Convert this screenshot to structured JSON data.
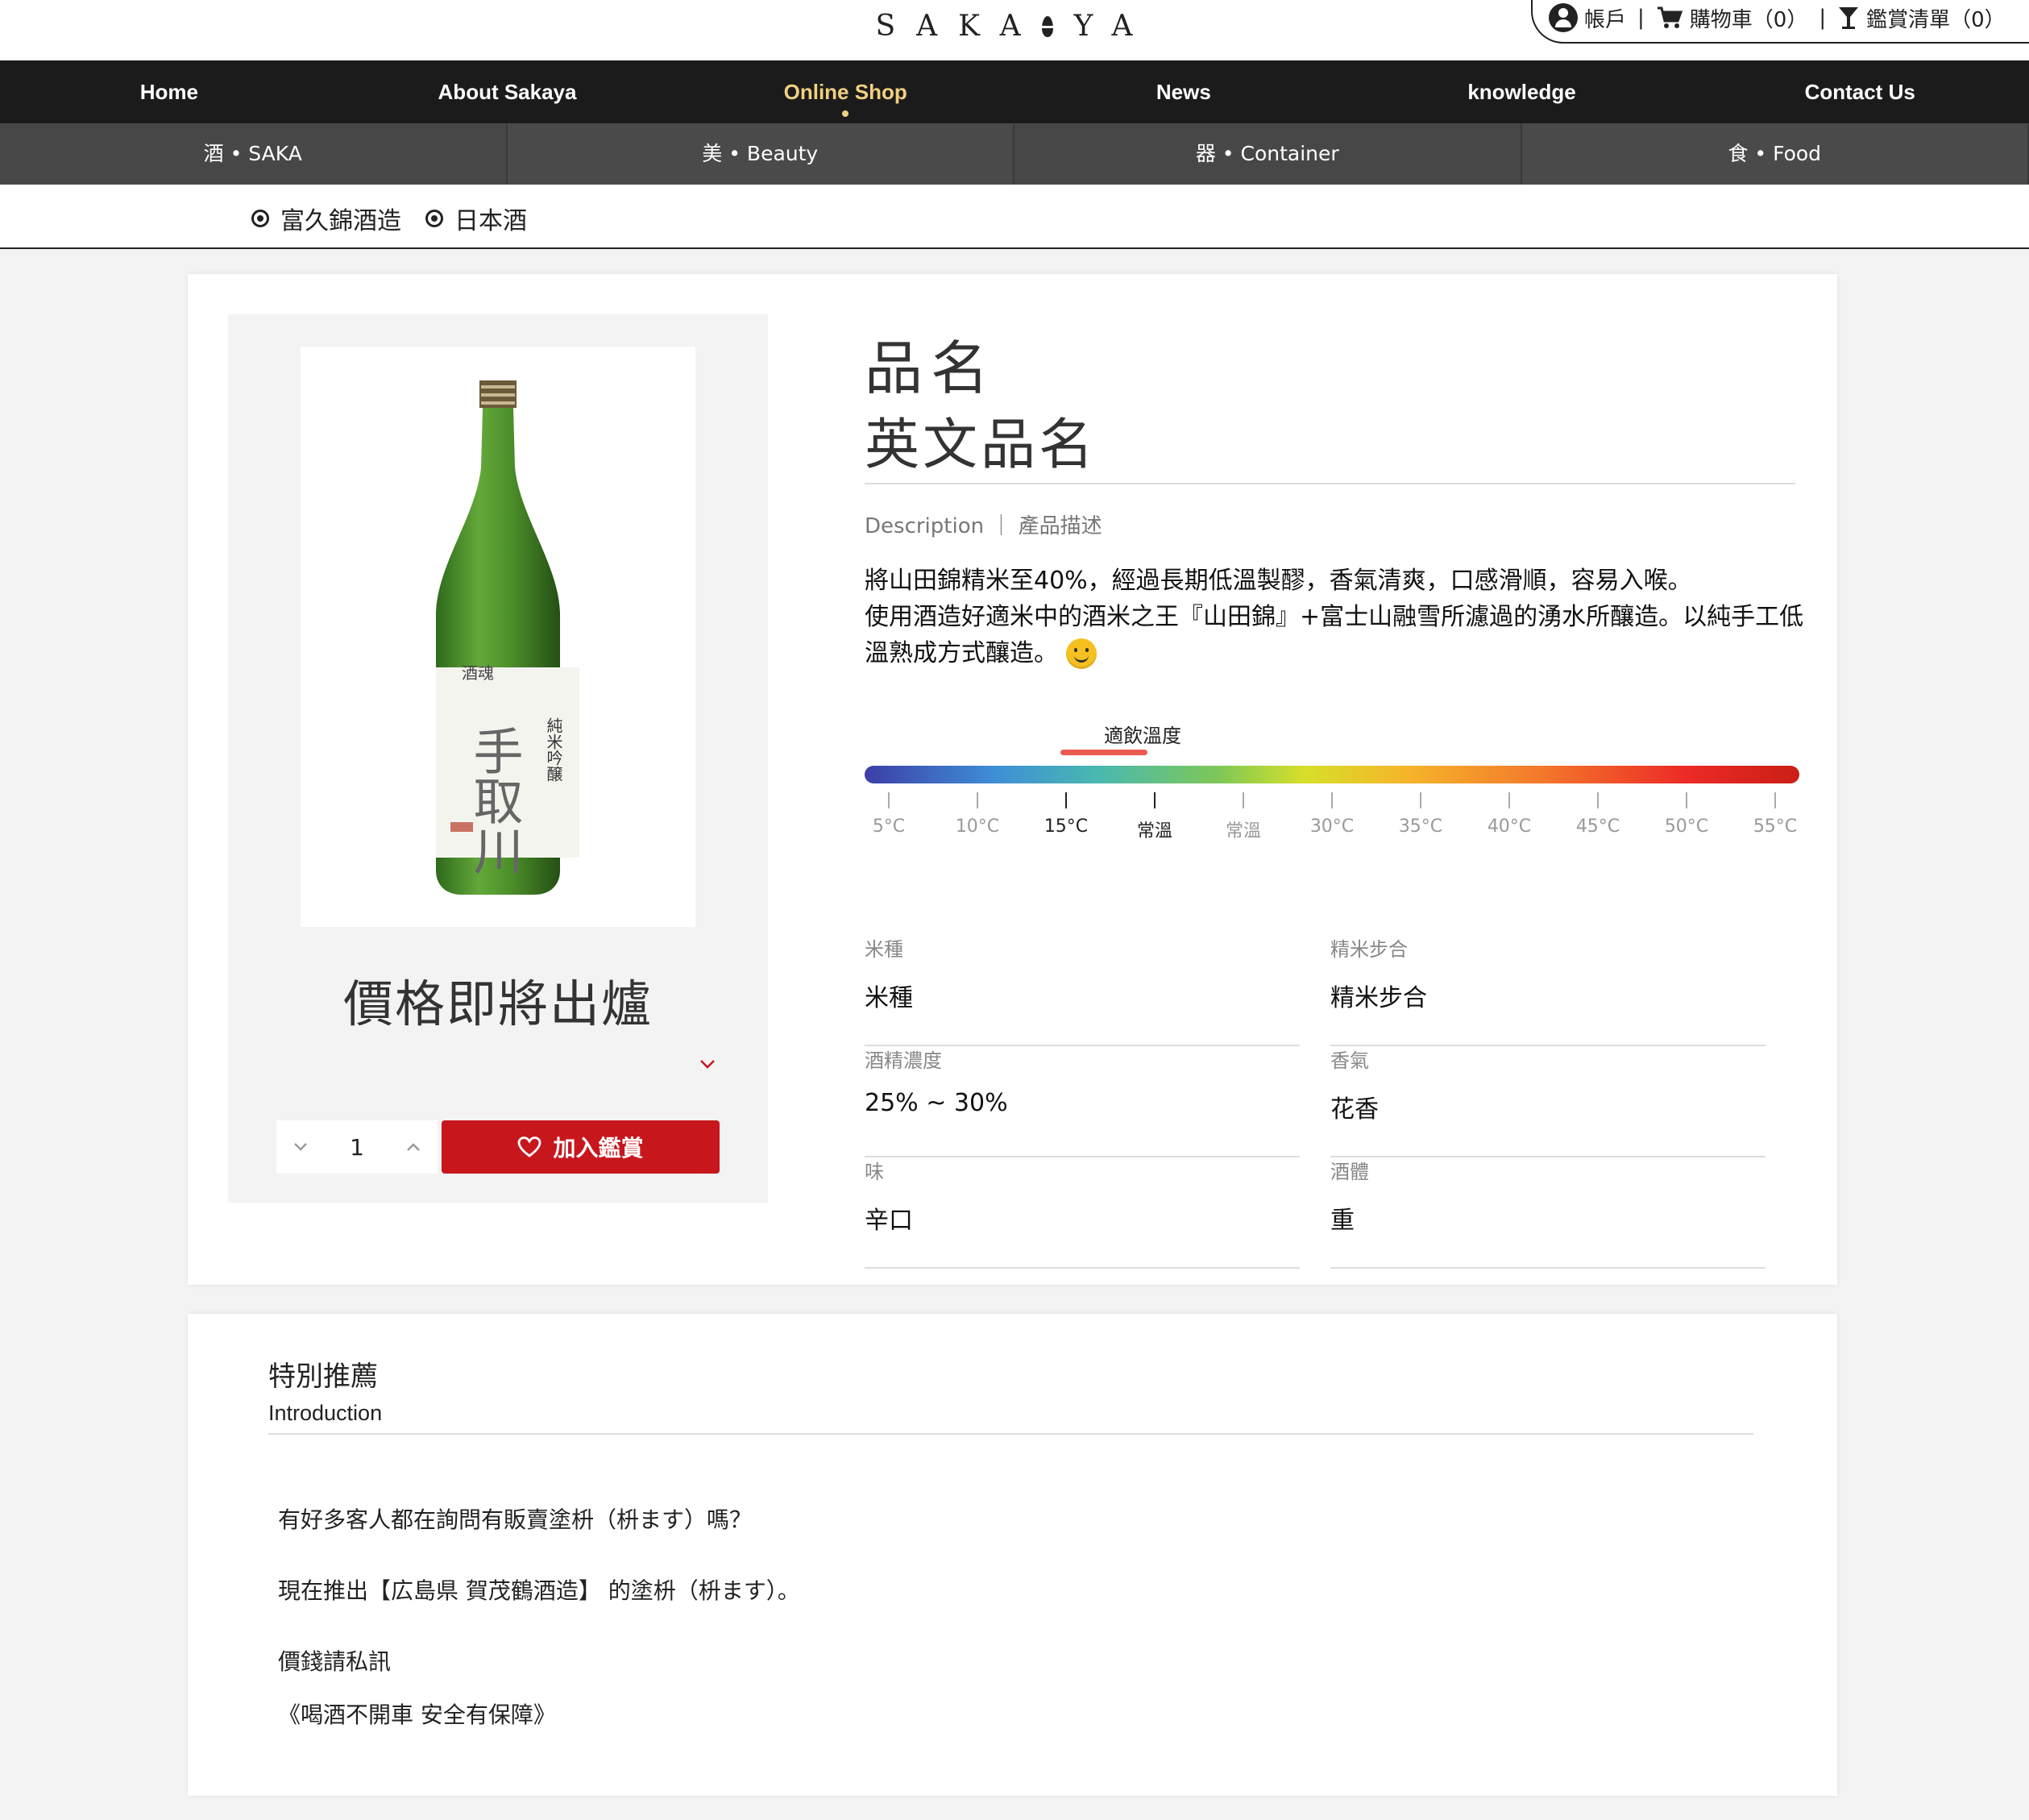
{
  "header": {
    "logo": "SAKA",
    "logo_end": "YA",
    "account_label": "帳戶",
    "cart_label": "購物車（0）",
    "wishlist_label": "鑑賞清單（0）"
  },
  "nav": {
    "items": [
      {
        "label": "Home"
      },
      {
        "label": "About Sakaya"
      },
      {
        "label": "Online Shop"
      },
      {
        "label": "News"
      },
      {
        "label": "knowledge"
      },
      {
        "label": "Contact Us"
      }
    ]
  },
  "subnav": {
    "items": [
      {
        "label": "酒 • SAKA"
      },
      {
        "label": "美 • Beauty"
      },
      {
        "label": "器 • Container"
      },
      {
        "label": "食 • Food"
      }
    ]
  },
  "breadcrumb": {
    "items": [
      {
        "label": "富久錦酒造"
      },
      {
        "label": "日本酒"
      }
    ]
  },
  "product": {
    "name": "品名",
    "english_name": "英文品名",
    "price_text": "價格即將出爐",
    "quantity": "1",
    "add_button": "加入鑑賞",
    "description_label": "Description ｜ 產品描述",
    "description_lines": [
      "將山田錦精米至40%，經過長期低溫製醪，香氣清爽，口感滑順，容易入喉。",
      "使用酒造好適米中的酒米之王『山田錦』+富士山融雪所濾過的湧水所釀造。以純手工低溫熟成方式釀造。"
    ],
    "bottle_label_text": "手取川",
    "bottle_label_top": "酒魂",
    "bottle_label_side": "純米吟醸",
    "temperature": {
      "label": "適飲溫度",
      "ticks": [
        "5°C",
        "10°C",
        "15°C",
        "常溫",
        "常溫",
        "30°C",
        "35°C",
        "40°C",
        "45°C",
        "50°C",
        "55°C"
      ],
      "highlight_from": 2,
      "highlight_to": 3
    },
    "specs": [
      {
        "label": "米種",
        "value": "米種"
      },
      {
        "label": "精米步合",
        "value": "精米步合"
      },
      {
        "label": "酒精濃度",
        "value": "25% ~ 30%"
      },
      {
        "label": "香氣",
        "value": "花香"
      },
      {
        "label": "味",
        "value": "辛口"
      },
      {
        "label": "酒體",
        "value": "重"
      }
    ]
  },
  "intro": {
    "title": "特別推薦",
    "subtitle": "Introduction",
    "paragraphs": [
      "有好多客人都在詢問有販賣塗枡（枡ます）嗎？",
      "現在推出【広島県 賀茂鶴酒造】 的塗枡（枡ます）。",
      "價錢請私訊",
      "《喝酒不開車 安全有保障》"
    ]
  },
  "colors": {
    "accent": "#c8161d",
    "nav_bg": "#1b1b1b",
    "nav_active": "#f0d080",
    "subnav_bg": "#4a4a4a"
  }
}
